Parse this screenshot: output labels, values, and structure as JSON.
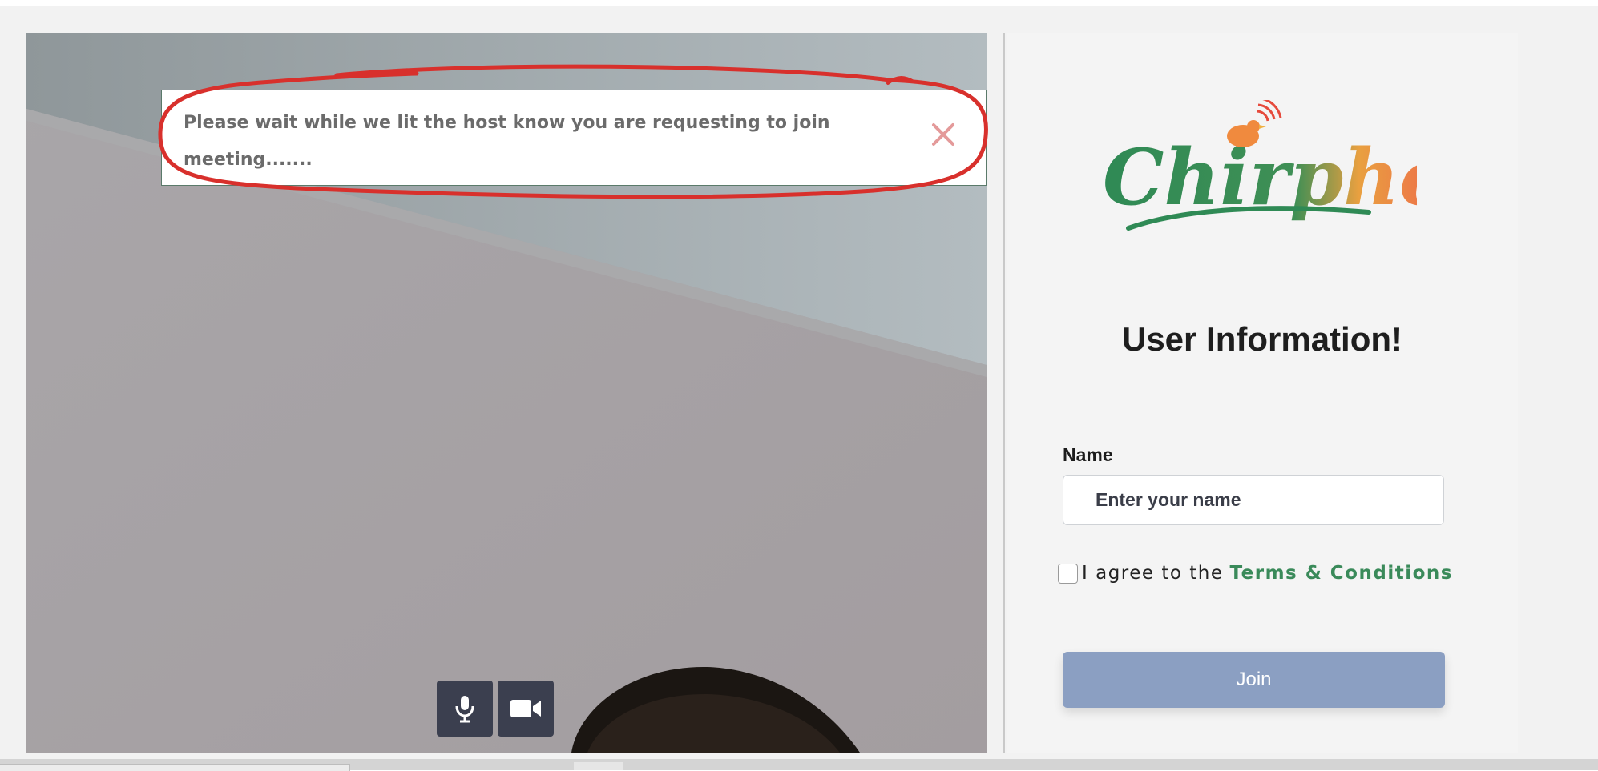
{
  "notification": {
    "message": "Please wait while we lit the host know you are requesting to join meeting.......",
    "close_icon": "close-icon"
  },
  "controls": {
    "mic_icon": "microphone-icon",
    "camera_icon": "video-camera-icon"
  },
  "panel": {
    "logo_text": "Chirphost",
    "title": "User Information!",
    "name_label": "Name",
    "name_placeholder": "Enter your name",
    "name_value": "",
    "agree_text": "I agree to the",
    "terms_link": "Terms & Conditions",
    "join_label": "Join"
  },
  "colors": {
    "brand_green": "#3a8a5a",
    "join_button": "#8b9fc2",
    "control_button": "#3b3f4f",
    "annotation_red": "#d8302c"
  }
}
